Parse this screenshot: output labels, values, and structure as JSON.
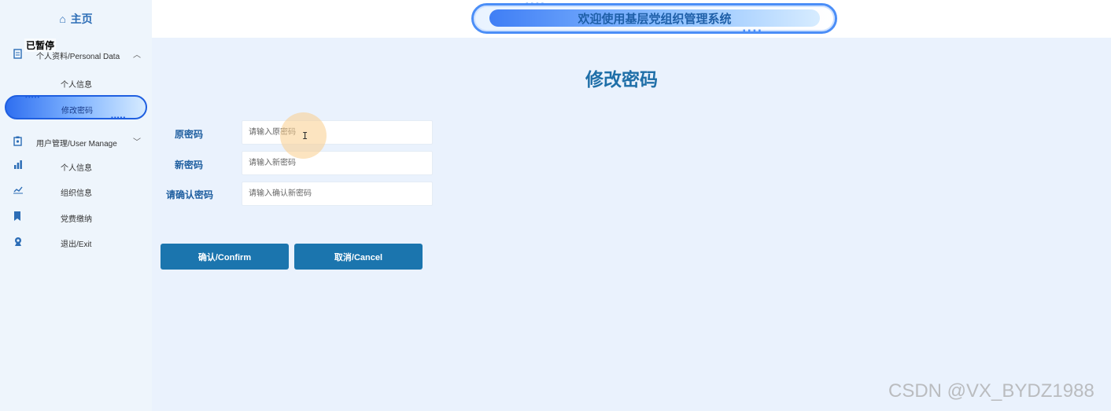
{
  "sidebar": {
    "home_label": "主页",
    "home_icon": "house-icon",
    "paused_overlay": "已暂停",
    "sections": [
      {
        "label": "个人资料/Personal Data",
        "icon": "document-icon",
        "expanded": true,
        "items": [
          {
            "label": "个人信息"
          },
          {
            "label": "修改密码",
            "active": true
          }
        ]
      },
      {
        "label": "用户管理/User Manage",
        "icon": "clipboard-user-icon",
        "expanded": true,
        "items": [
          {
            "label": "个人信息",
            "icon": "bar-chart-icon"
          },
          {
            "label": "组织信息",
            "icon": "line-chart-icon"
          },
          {
            "label": "党费缴纳",
            "icon": "bookmark-icon"
          },
          {
            "label": "退出/Exit",
            "icon": "user-badge-icon"
          }
        ]
      }
    ]
  },
  "header": {
    "banner_title": "欢迎使用基层党组织管理系统"
  },
  "main": {
    "title": "修改密码",
    "fields": [
      {
        "label": "原密码",
        "placeholder": "请输入原密码",
        "value": ""
      },
      {
        "label": "新密码",
        "placeholder": "请输入新密码",
        "value": ""
      },
      {
        "label": "请确认密码",
        "placeholder": "请输入确认新密码",
        "value": ""
      }
    ],
    "confirm_label": "确认/Confirm",
    "cancel_label": "取消/Cancel"
  },
  "watermark": "CSDN @VX_BYDZ1988",
  "colors": {
    "accent": "#1b75ae",
    "title": "#1f6fa8",
    "banner_border": "#4b8ef7",
    "page_bg": "#eaf2fd",
    "sidebar_bg": "#eef5fc"
  }
}
